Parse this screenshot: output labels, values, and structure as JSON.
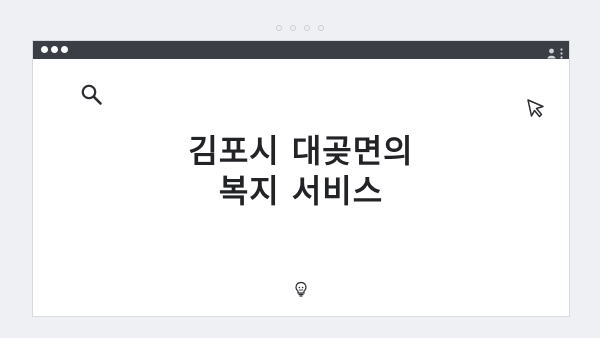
{
  "top_indicator": {
    "dots": [
      "dot-1",
      "dot-2",
      "dot-3",
      "dot-4"
    ]
  },
  "window": {
    "titlebar": {
      "controls": [
        "close",
        "minimize",
        "maximize"
      ],
      "right_icons": [
        "user-icon",
        "kebab-menu-icon"
      ]
    },
    "content": {
      "headline_line_1": "김포시 대곶면의",
      "headline_line_2": "복지 서비스",
      "icons": {
        "search": "search-icon",
        "cursor": "cursor-arrow-icon",
        "lightbulb": "lightbulb-icon"
      }
    }
  },
  "colors": {
    "titlebar": "#3b3f45",
    "background": "#eef0f3",
    "text": "#222326"
  }
}
